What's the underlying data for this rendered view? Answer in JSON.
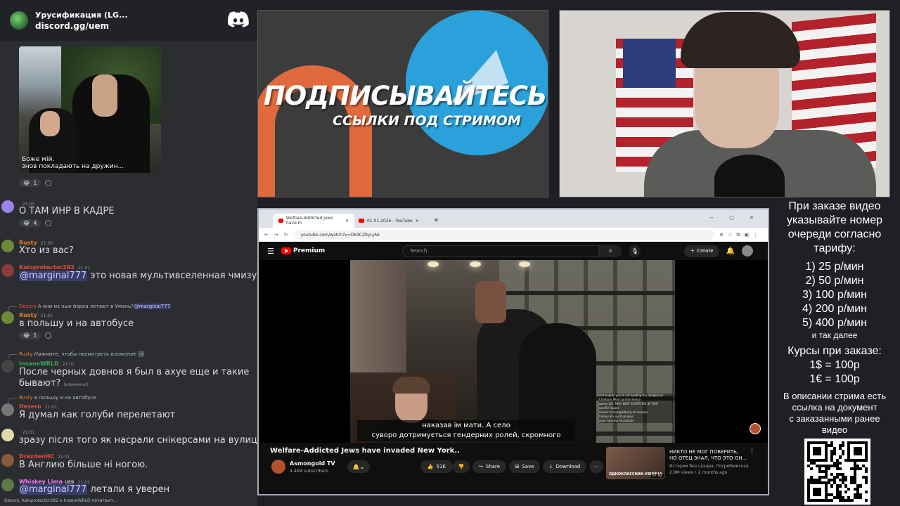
{
  "chat": {
    "server_name": "Урусификация (LG...",
    "invite": "discord.gg/uem",
    "image_caption_1": "Боже мій.",
    "image_caption_2": "знов покладають на дружин...",
    "messages": [
      {
        "user": "",
        "time": "21:00",
        "text": "О ТАМ ИНР В КАДРЕ",
        "color": "#9b84ec",
        "reaction": "4"
      },
      {
        "user": "Rusty",
        "time": "21:00",
        "text": "Хто из вас?",
        "color": "#e67e22"
      },
      {
        "user": "Kaloprotector282",
        "time": "21:01",
        "mention": "@marginal777",
        "text": " это новая мультивселенная чмизумия?",
        "color": "#e74c3c"
      },
      {
        "reply_user": "Dezero",
        "reply_text": "А они из нью йорка летают в Умань?",
        "reply_mention": "@marginal777",
        "user": "Rusty",
        "time": "21:01",
        "text": "в польшу и на автобусе",
        "color": "#e67e22",
        "reaction": "1"
      },
      {
        "reply_user": "Rusty",
        "reply_text": "Нажмите, чтобы посмотреть вложение",
        "user": "InsaneWRLD",
        "time": "21:01",
        "text": "После черных довнов я был в ахуе  еще и такие бывают?",
        "edited": "(изменено)",
        "color": "#3ba55c"
      },
      {
        "reply_user": "Rusty",
        "reply_text": "в польшу и на автобусе",
        "user": "Dezero",
        "time": "21:01",
        "text": "Я думал как голуби перелетают",
        "color": "#e74c3c"
      },
      {
        "user": "",
        "time": "21:01",
        "text": "зразу після того як насрали снікерсами на вулицях",
        "color": "#3ba55c"
      },
      {
        "user": "DrezdenHC",
        "time": "21:01",
        "text": "В Англию більше ні ногою.",
        "color": "#e74c3c"
      },
      {
        "user": "Whiskey Lima",
        "badge": "UEB",
        "time": "21:01",
        "mention": "@marginal777",
        "text": " летали я уверен",
        "color": "#f47fff"
      }
    ],
    "first_reaction": "1",
    "typing": "Dezero, Kaloprotector282 и InsaneWRLD печатают..."
  },
  "promo": {
    "title": "ПОДПИСЫВАЙТЕСЬ",
    "subtitle": "ССЫЛКИ ПОД СТРИМОМ"
  },
  "browser": {
    "tabs": [
      "Welfare-Addicted Jews have in",
      "01.01.2026 - YouTube"
    ],
    "url": "youtube.com/watch?v=Dk9CZ9yLyNc",
    "new_tab": "+",
    "window_controls": "− ▢ ✕"
  },
  "youtube": {
    "logo": "Premium",
    "search_placeholder": "Search",
    "create": "Create",
    "subtitle_line1": "наказав їм мати.  А село",
    "subtitle_line2": "суворо дотримується гендерних ролей, скромного",
    "overlay_chat": [
      "Asmongold  you're not beating the allegations",
      "ChatUser  Mind control device",
      "gamer101  THEY KEEP SCRIPTURE IN THAT",
      "user93  Report",
      "Viewer  Asmongoldberg lol clueless",
      "fanboy  BG spiritual gear",
      "anon  housing foundation"
    ],
    "video_title": "Welfare-Addicted Jews have invaded New York..",
    "channel": "Asmongold TV",
    "subscribers": "4.44M subscribers",
    "likes": "51K",
    "share": "Share",
    "save": "Save",
    "download": "Download",
    "rec_title_1": "НИКТО НЕ МОГ ПОВЕРИТЬ,",
    "rec_title_2": "НО ОТЕЦ ЗНАЛ, ЧТО ЭТО ОН...",
    "rec_channel": "Истории без сахара. Погребижская.",
    "rec_meta": "2.9M views • 2 months ago",
    "rec_thumb_text": "ОДНОКЛАССНИК-УБИЙЦА",
    "rec_duration": "57:02"
  },
  "info": {
    "header": [
      "При заказе видео",
      "указывайте номер",
      "очереди согласно",
      "тарифу:"
    ],
    "tariffs": [
      "1) 25 р/мин",
      "2) 50 р/мин",
      "3) 100 р/мин",
      "4) 200 р/мин",
      "5) 400 р/мин"
    ],
    "etc": "и так далее",
    "courses_title": "Курсы при заказе:",
    "rates": [
      "1$ = 100р",
      "1€ = 100р"
    ],
    "footer": [
      "В описании стрима есть",
      "ссылка на документ",
      "с заказанными ранее",
      "видео"
    ]
  }
}
